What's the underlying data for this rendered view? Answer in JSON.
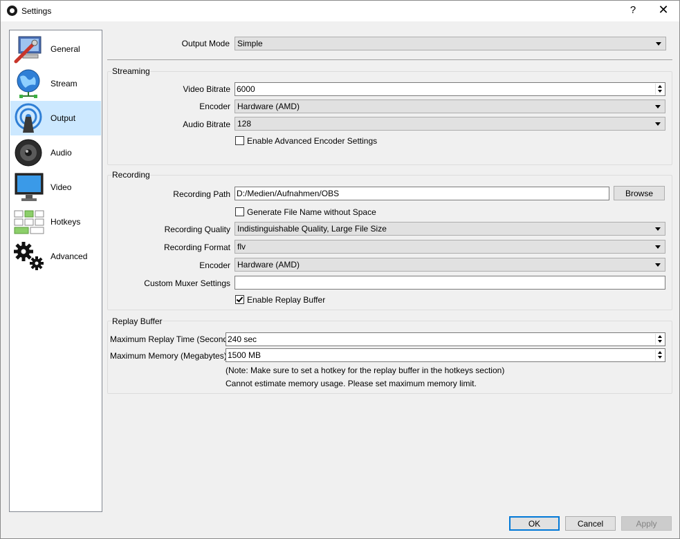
{
  "window": {
    "title": "Settings",
    "help_label": "?",
    "close_label": "✕"
  },
  "sidebar": {
    "items": [
      {
        "label": "General",
        "icon": "general-icon"
      },
      {
        "label": "Stream",
        "icon": "stream-icon"
      },
      {
        "label": "Output",
        "icon": "output-icon",
        "selected": true
      },
      {
        "label": "Audio",
        "icon": "audio-icon"
      },
      {
        "label": "Video",
        "icon": "video-icon"
      },
      {
        "label": "Hotkeys",
        "icon": "hotkeys-icon"
      },
      {
        "label": "Advanced",
        "icon": "advanced-icon"
      }
    ]
  },
  "output_mode": {
    "label": "Output Mode",
    "value": "Simple"
  },
  "streaming": {
    "title": "Streaming",
    "video_bitrate": {
      "label": "Video Bitrate",
      "value": "6000"
    },
    "encoder": {
      "label": "Encoder",
      "value": "Hardware (AMD)"
    },
    "audio_bitrate": {
      "label": "Audio Bitrate",
      "value": "128"
    },
    "advanced_encoder": {
      "label": "Enable Advanced Encoder Settings",
      "checked": false
    }
  },
  "recording": {
    "title": "Recording",
    "path": {
      "label": "Recording Path",
      "value": "D:/Medien/Aufnahmen/OBS"
    },
    "browse_label": "Browse",
    "no_space": {
      "label": "Generate File Name without Space",
      "checked": false
    },
    "quality": {
      "label": "Recording Quality",
      "value": "Indistinguishable Quality, Large File Size"
    },
    "format": {
      "label": "Recording Format",
      "value": "flv"
    },
    "encoder": {
      "label": "Encoder",
      "value": "Hardware (AMD)"
    },
    "muxer": {
      "label": "Custom Muxer Settings",
      "value": ""
    },
    "replay_buffer": {
      "label": "Enable Replay Buffer",
      "checked": true
    }
  },
  "replay": {
    "title": "Replay Buffer",
    "max_time": {
      "label": "Maximum Replay Time (Seconds)",
      "value": "240 sec"
    },
    "max_memory": {
      "label": "Maximum Memory (Megabytes)",
      "value": "1500 MB"
    },
    "note": "(Note: Make sure to set a hotkey for the replay buffer in the hotkeys section)",
    "memory_status": "Cannot estimate memory usage.  Please set maximum memory limit."
  },
  "footer": {
    "ok_label": "OK",
    "cancel_label": "Cancel",
    "apply_label": "Apply"
  },
  "colors": {
    "selection": "#cce8ff",
    "primary_border": "#0078d7",
    "background": "#f0f0f0"
  }
}
